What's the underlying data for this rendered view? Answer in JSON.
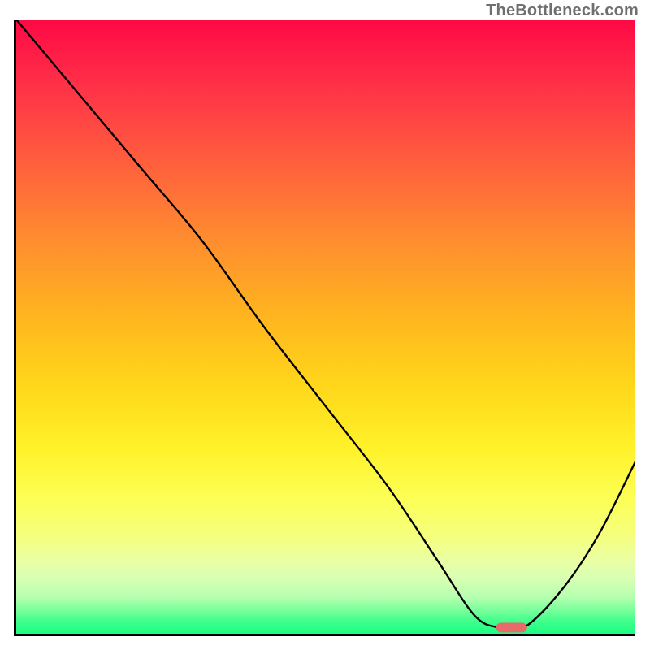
{
  "watermark": "TheBottleneck.com",
  "chart_data": {
    "type": "line",
    "title": "",
    "xlabel": "",
    "ylabel": "",
    "xlim": [
      0,
      100
    ],
    "ylim": [
      0,
      100
    ],
    "axes_shown": {
      "left": true,
      "bottom": true,
      "ticks": false,
      "grid": false
    },
    "background_gradient": {
      "direction": "vertical",
      "stops": [
        {
          "pos": 0.0,
          "color": "#ff0845"
        },
        {
          "pos": 0.5,
          "color": "#ffc01a"
        },
        {
          "pos": 0.8,
          "color": "#fbff60"
        },
        {
          "pos": 1.0,
          "color": "#1cfd83"
        }
      ]
    },
    "series": [
      {
        "name": "bottleneck-curve",
        "x": [
          0,
          10,
          20,
          30,
          40,
          50,
          60,
          68,
          74,
          78,
          82,
          88,
          94,
          100
        ],
        "y": [
          100,
          88,
          76,
          64,
          50,
          37,
          24,
          12,
          3,
          1,
          1,
          7,
          16,
          28
        ]
      }
    ],
    "marker": {
      "name": "optimal-range",
      "shape": "pill",
      "x_center": 80,
      "y": 1,
      "width_x_units": 5,
      "color": "#e86a6a"
    }
  }
}
